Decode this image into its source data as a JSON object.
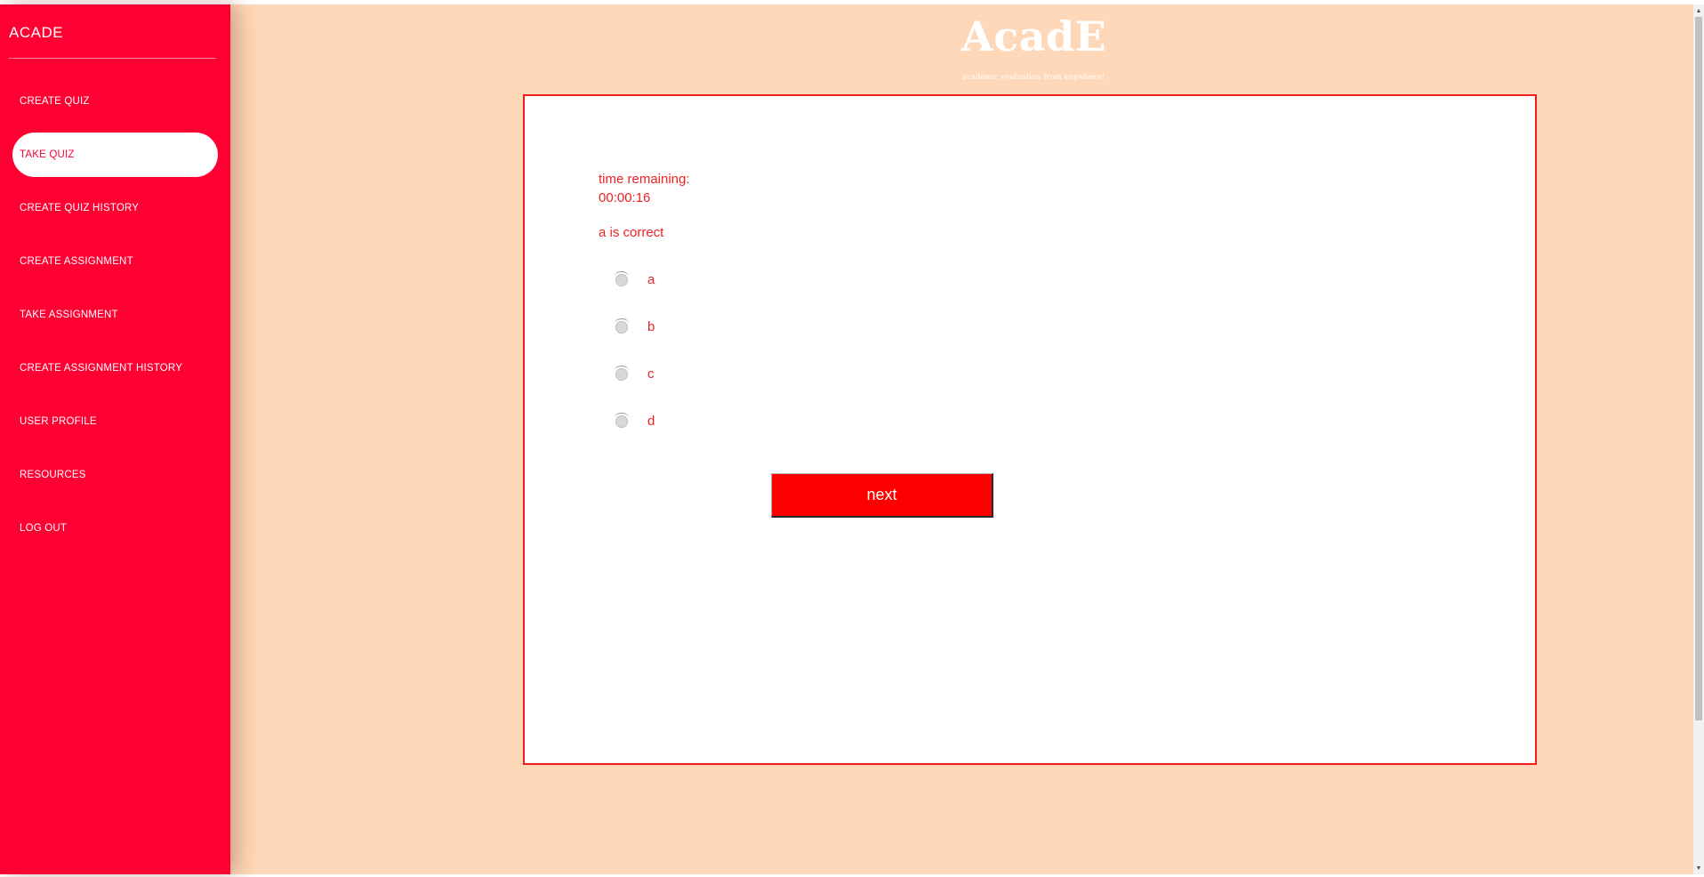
{
  "sidebar": {
    "brand": "ACADE",
    "items": [
      {
        "label": "CREATE QUIZ",
        "active": false
      },
      {
        "label": "TAKE QUIZ",
        "active": true
      },
      {
        "label": "CREATE QUIZ HISTORY",
        "active": false
      },
      {
        "label": "CREATE ASSIGNMENT",
        "active": false
      },
      {
        "label": "TAKE ASSIGNMENT",
        "active": false
      },
      {
        "label": "CREATE ASSIGNMENT HISTORY",
        "active": false
      },
      {
        "label": "USER PROFILE",
        "active": false
      },
      {
        "label": "RESOURCES",
        "active": false
      },
      {
        "label": "LOG OUT",
        "active": false
      }
    ]
  },
  "header": {
    "title": "AcadE",
    "subtitle": "academic evaluation from anywhere!"
  },
  "quiz": {
    "timer_label": "time remaining:",
    "timer_value": "00:00:16",
    "question": "a is correct",
    "options": [
      "a",
      "b",
      "c",
      "d"
    ],
    "next_label": "next"
  },
  "colors": {
    "accent": "#ff0033",
    "background": "#fed8b8",
    "card_border": "#f21d1d",
    "button": "#fc0000",
    "text_red": "#ee2222"
  },
  "icons": {
    "radio": "radio-unchecked-icon",
    "scroll_up": "triangle-up-icon",
    "scroll_down": "triangle-down-icon"
  }
}
